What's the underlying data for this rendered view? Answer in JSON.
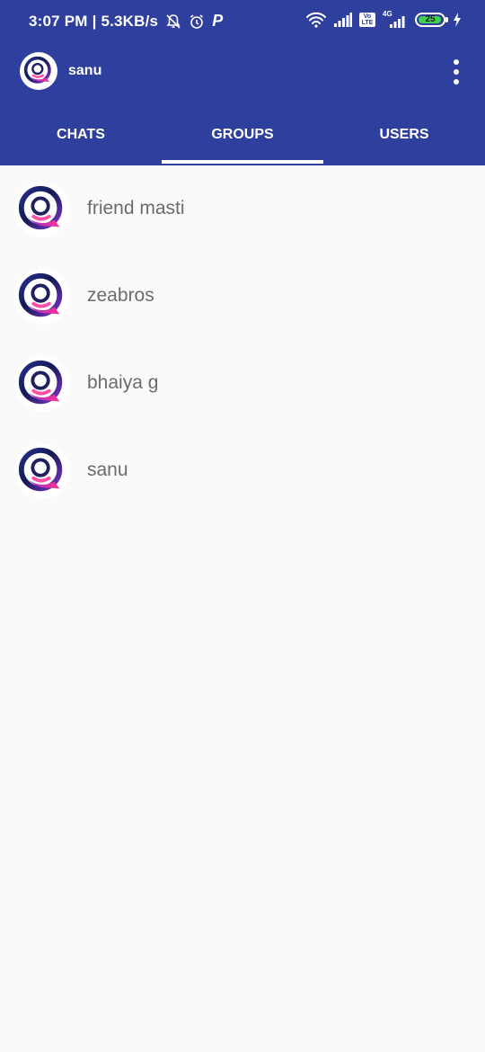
{
  "status_bar": {
    "time_speed": "3:07 PM | 5.3KB/s",
    "p_icon": "P",
    "volte": "Vo\nLTE",
    "network": "4G",
    "battery": "25"
  },
  "toolbar": {
    "title": "sanu"
  },
  "tabs": [
    {
      "label": "CHATS"
    },
    {
      "label": "GROUPS"
    },
    {
      "label": "USERS"
    }
  ],
  "groups": [
    {
      "name": "friend masti"
    },
    {
      "name": "zeabros"
    },
    {
      "name": "bhaiya g"
    },
    {
      "name": "sanu"
    }
  ],
  "colors": {
    "appbar": "#2f3f9e",
    "background": "#fafafa",
    "group_text": "#6b6b6b"
  },
  "icons": {
    "app_logo": "chat-bubble-logo-icon",
    "overflow": "more-vert-icon"
  }
}
